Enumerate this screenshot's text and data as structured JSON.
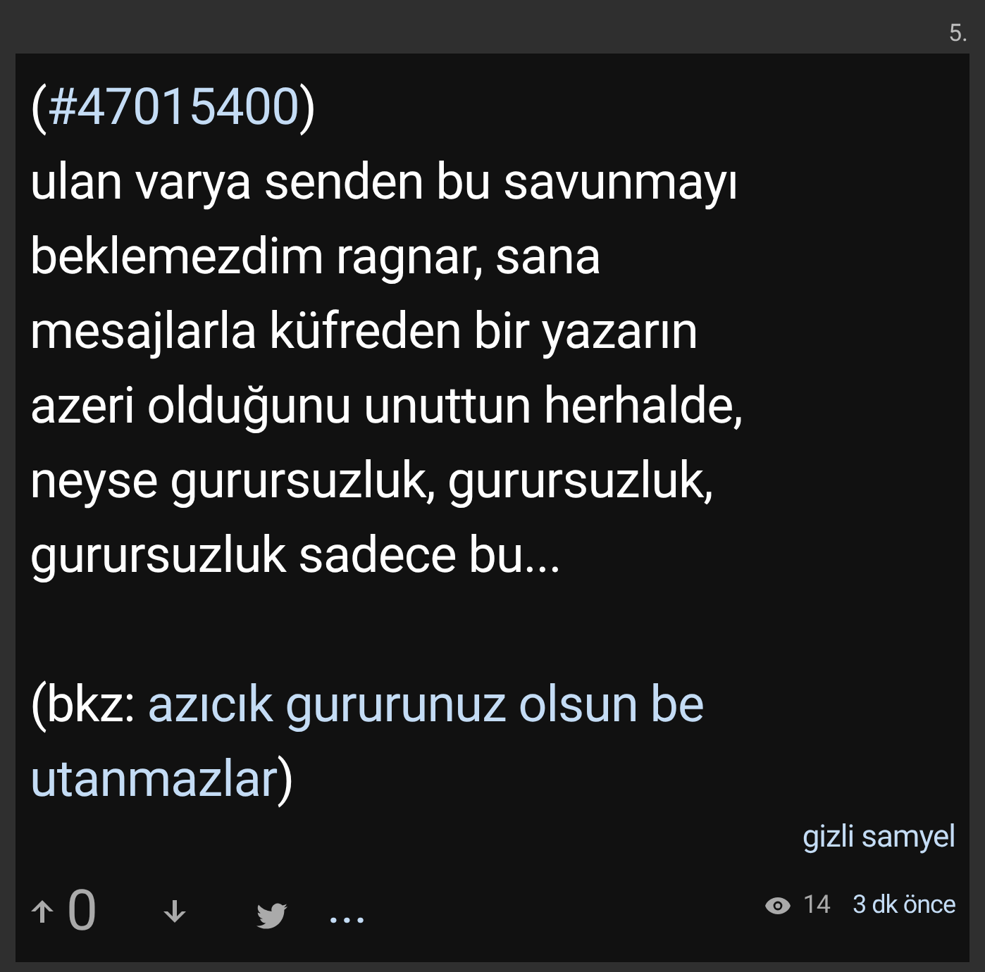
{
  "entry_number": "5.",
  "reference": [
    {
      "kind": "text",
      "text": "("
    },
    {
      "kind": "link",
      "text": "#47015400"
    },
    {
      "kind": "text",
      "text": ")"
    }
  ],
  "body_lines": [
    "ulan varya senden bu savunmayı",
    "beklemezdim ragnar, sana",
    "mesajlarla küfreden bir yazarın",
    "azeri olduğunu unuttun herhalde,",
    "neyse gurursuzluk, gurursuzluk,",
    "gurursuzluk sadece bu..."
  ],
  "see_also": [
    {
      "kind": "text",
      "text": "(bkz: "
    },
    {
      "kind": "link",
      "text": "azıcık gururunuz olsun be"
    },
    {
      "kind": "break"
    },
    {
      "kind": "link",
      "text": "utanmazlar"
    },
    {
      "kind": "text",
      "text": ")"
    }
  ],
  "author": "gizli samyel",
  "views": "14",
  "time": "3 dk önce",
  "votes": "0",
  "more": "..."
}
